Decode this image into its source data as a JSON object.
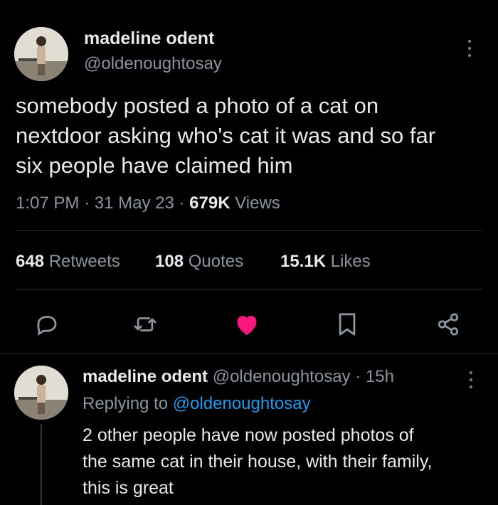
{
  "tweet": {
    "author_name": "madeline odent",
    "author_handle": "@oldenoughtosay",
    "text_line1": "somebody posted a photo of a cat on",
    "text_line2": "nextdoor asking who's cat it was and so far",
    "text_line3": "six people have claimed him",
    "time": "1:07 PM",
    "date": "31 May 23",
    "views_count": "679K",
    "views_label": "Views",
    "sep": "·"
  },
  "stats": {
    "retweets_count": "648",
    "retweets_label": "Retweets",
    "quotes_count": "108",
    "quotes_label": "Quotes",
    "likes_count": "15.1K",
    "likes_label": "Likes"
  },
  "actions": {
    "icons": [
      "reply-icon",
      "retweet-icon",
      "like-icon",
      "bookmark-icon",
      "share-icon"
    ],
    "like_color": "#f91880"
  },
  "reply": {
    "author_name": "madeline odent",
    "author_handle": "@oldenoughtosay",
    "sep": "·",
    "age": "15h",
    "replying_label": "Replying to",
    "replying_handle": "@oldenoughtosay",
    "text_line1": "2 other people have now posted photos of",
    "text_line2": "the same cat in their house, with their family,",
    "text_line3": "this is great"
  }
}
